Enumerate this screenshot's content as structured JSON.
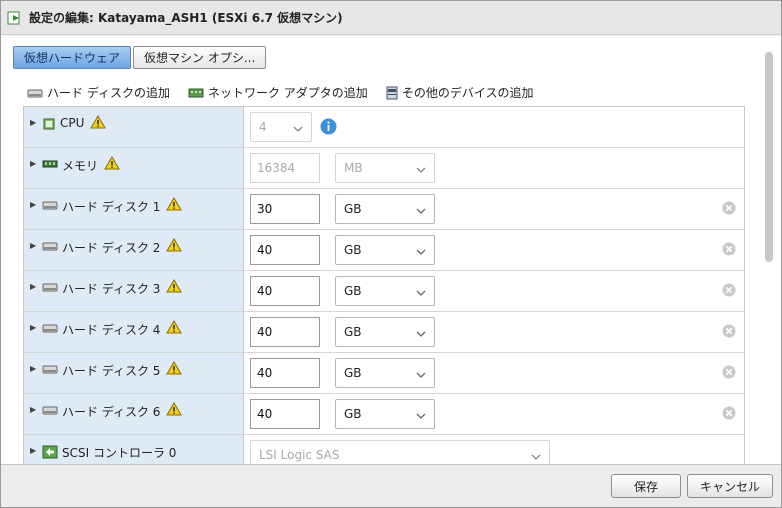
{
  "window": {
    "title": "設定の編集: Katayama_ASH1 (ESXi 6.7 仮想マシン)",
    "title_icon": "edit-vm-icon"
  },
  "tabs": [
    {
      "label": "仮想ハードウェア",
      "active": true
    },
    {
      "label": "仮想マシン オプシ...",
      "active": false
    }
  ],
  "actions": {
    "add_hard_disk": "ハード ディスクの追加",
    "add_network_adapter": "ネットワーク アダプタの追加",
    "add_other_device": "その他のデバイスの追加"
  },
  "rows": {
    "cpu": {
      "label": "CPU",
      "value": "4"
    },
    "memory": {
      "label": "メモリ",
      "value": "16384",
      "unit": "MB"
    },
    "disk1": {
      "label": "ハード ディスク 1",
      "value": "30",
      "unit": "GB"
    },
    "disk2": {
      "label": "ハード ディスク 2",
      "value": "40",
      "unit": "GB"
    },
    "disk3": {
      "label": "ハード ディスク 3",
      "value": "40",
      "unit": "GB"
    },
    "disk4": {
      "label": "ハード ディスク 4",
      "value": "40",
      "unit": "GB"
    },
    "disk5": {
      "label": "ハード ディスク 5",
      "value": "40",
      "unit": "GB"
    },
    "disk6": {
      "label": "ハード ディスク 6",
      "value": "40",
      "unit": "GB"
    },
    "scsi": {
      "label": "SCSI コントローラ 0",
      "value": "LSI Logic SAS"
    }
  },
  "footer": {
    "save_label": "保存",
    "cancel_label": "キャンセル"
  },
  "colors": {
    "tab_active": "#6ea5e4",
    "row_label_bg": "#deeaf6",
    "warning": "#f3d21a",
    "info": "#3d8fd9"
  }
}
